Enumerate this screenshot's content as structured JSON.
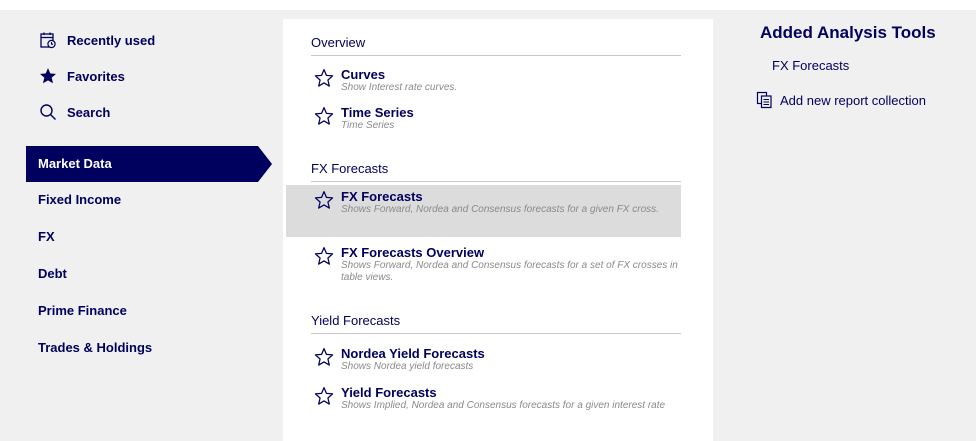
{
  "nav_top": [
    {
      "label": "Recently used",
      "icon": "recent-calendar-icon"
    },
    {
      "label": "Favorites",
      "icon": "star-filled-icon"
    },
    {
      "label": "Search",
      "icon": "search-icon"
    }
  ],
  "categories": [
    {
      "label": "Market Data",
      "active": true
    },
    {
      "label": "Fixed Income",
      "active": false
    },
    {
      "label": "FX",
      "active": false
    },
    {
      "label": "Debt",
      "active": false
    },
    {
      "label": "Prime Finance",
      "active": false
    },
    {
      "label": "Trades & Holdings",
      "active": false
    }
  ],
  "sections": [
    {
      "title": "Overview",
      "items": [
        {
          "title": "Curves",
          "desc": "Show Interest rate curves."
        },
        {
          "title": "Time Series",
          "desc": "Time Series"
        }
      ]
    },
    {
      "title": "FX Forecasts",
      "items": [
        {
          "title": "FX Forecasts",
          "desc": "Shows Forward, Nordea and Consensus forecasts for a given FX cross.",
          "highlighted": true
        },
        {
          "title": "FX Forecasts Overview",
          "desc": "Shows Forward, Nordea and Consensus forecasts for a set of FX crosses in table views."
        }
      ]
    },
    {
      "title": "Yield Forecasts",
      "items": [
        {
          "title": "Nordea Yield Forecasts",
          "desc": "Shows Nordea yield forecasts"
        },
        {
          "title": "Yield Forecasts",
          "desc": "Shows Implied, Nordea and Consensus forecasts for a given interest rate"
        }
      ]
    }
  ],
  "added_tools": {
    "title": "Added Analysis Tools",
    "items": [
      "FX Forecasts"
    ],
    "add_label": "Add new report collection"
  },
  "colors": {
    "primary": "#00005e",
    "panel_bg": "#f0f0f0",
    "highlight": "#dcdcdc",
    "desc_text": "#8a8a8a"
  }
}
